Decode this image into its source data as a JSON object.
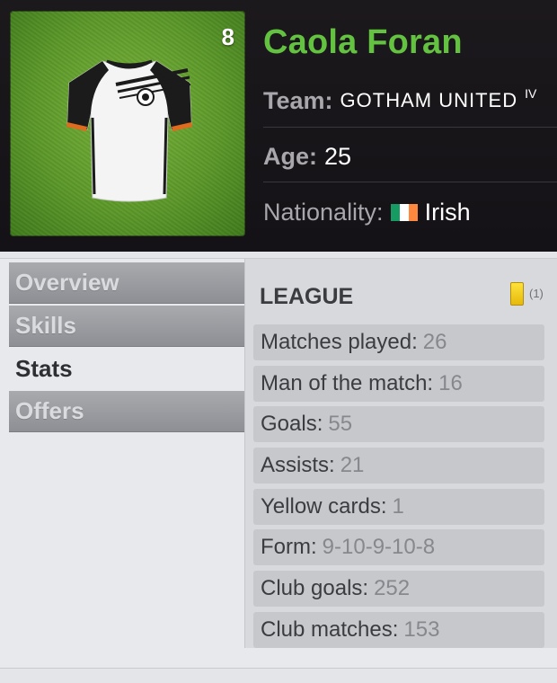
{
  "player": {
    "name": "Caola Foran",
    "shirt_number": "8",
    "team_label": "Team:",
    "team": "GOTHAM UNITED",
    "team_suffix": "IV",
    "age_label": "Age:",
    "age": "25",
    "nationality_label": "Nationality:",
    "nationality": "Irish",
    "flag_colors": [
      "#169b62",
      "#ffffff",
      "#ff883e"
    ]
  },
  "nav": {
    "items": [
      {
        "label": "Overview"
      },
      {
        "label": "Skills"
      },
      {
        "label": "Stats",
        "active": true
      },
      {
        "label": "Offers"
      }
    ]
  },
  "stats": {
    "title": "LEAGUE",
    "card_icon": "yellow-card-icon",
    "card_count": "(1)",
    "rows": [
      {
        "label": "Matches played:",
        "value": "26"
      },
      {
        "label": "Man of the match:",
        "value": "16"
      },
      {
        "label": "Goals:",
        "value": "55"
      },
      {
        "label": "Assists:",
        "value": "21"
      },
      {
        "label": "Yellow cards:",
        "value": "1"
      },
      {
        "label": "Form:",
        "value": "9-10-9-10-8"
      },
      {
        "label": "Club goals:",
        "value": "252"
      },
      {
        "label": "Club matches:",
        "value": "153"
      }
    ]
  },
  "colors": {
    "name_accent": "#63c23f",
    "header_bg": "#1c191d",
    "pitch_green": "#5d9a2a"
  }
}
